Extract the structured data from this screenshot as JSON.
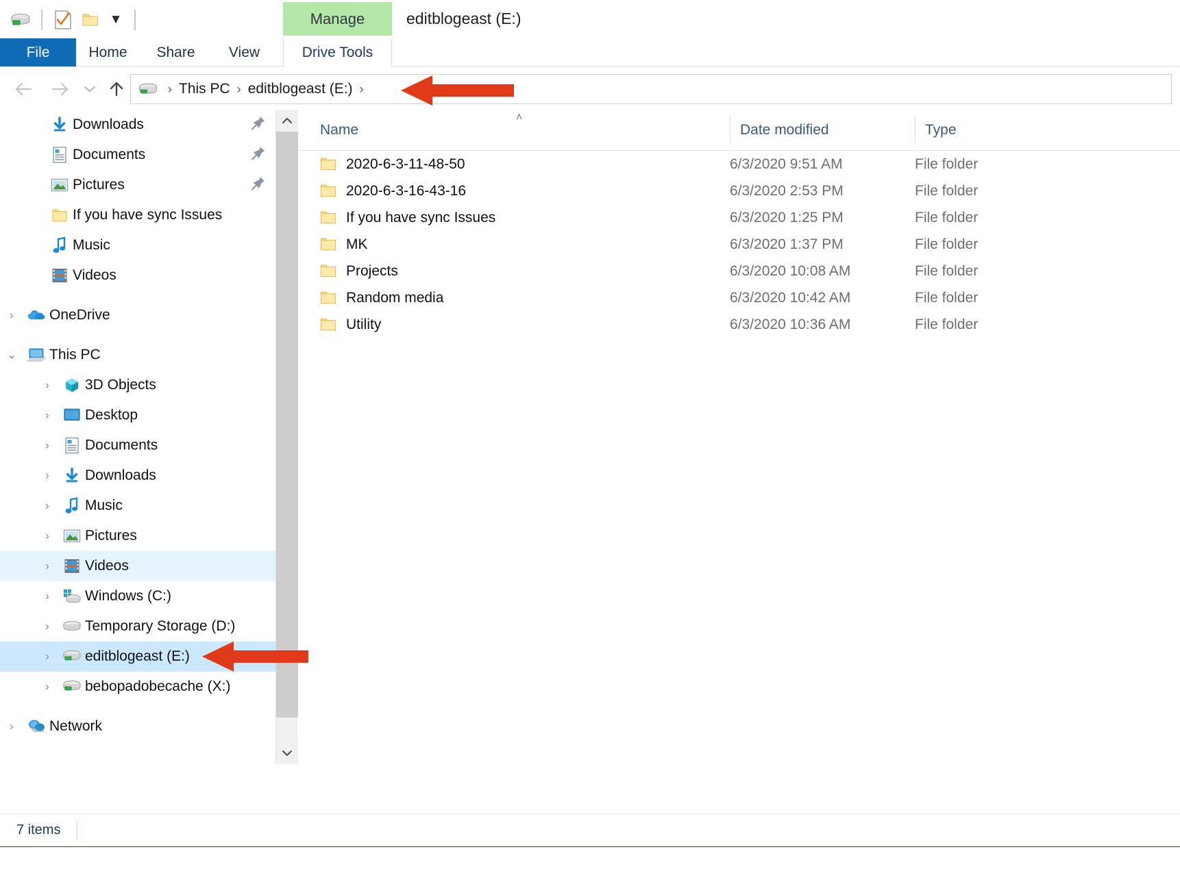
{
  "window": {
    "title": "editblogeast (E:)",
    "contextual_tab_group": "Manage",
    "accent_blue": "#0d6cb5",
    "contextual_green": "#b4e8a8",
    "selection_blue": "#cce8ff",
    "annotation_red": "#e03a18"
  },
  "quick_access_toolbar": {
    "drive_icon": "drive-icon",
    "properties_icon": "properties-checklist-icon",
    "new_folder_icon": "new-folder-icon",
    "customize_caret": "▼"
  },
  "ribbon": {
    "tabs": [
      {
        "label": "File",
        "name": "tab-file",
        "active": false
      },
      {
        "label": "Home",
        "name": "tab-home",
        "active": false
      },
      {
        "label": "Share",
        "name": "tab-share",
        "active": false
      },
      {
        "label": "View",
        "name": "tab-view",
        "active": false
      },
      {
        "label": "Drive Tools",
        "name": "tab-drive-tools",
        "active": true
      }
    ]
  },
  "navigation": {
    "back": "←",
    "forward": "→",
    "recent_locations": "⌄",
    "up": "↑",
    "breadcrumb": {
      "icon": "drive-icon",
      "items": [
        "This PC",
        "editblogeast (E:)"
      ],
      "separator": "›",
      "trailing_separator": "›"
    }
  },
  "sidebar": {
    "quick_access": [
      {
        "label": "Downloads",
        "icon": "downloads-arrow-icon",
        "pinned": true
      },
      {
        "label": "Documents",
        "icon": "document-icon",
        "pinned": true
      },
      {
        "label": "Pictures",
        "icon": "pictures-icon",
        "pinned": true
      },
      {
        "label": "If you have sync Issues",
        "icon": "folder-icon",
        "pinned": false
      },
      {
        "label": "Music",
        "icon": "music-note-icon",
        "pinned": false
      },
      {
        "label": "Videos",
        "icon": "videos-filmstrip-icon",
        "pinned": false
      }
    ],
    "onedrive": {
      "label": "OneDrive",
      "icon": "onedrive-cloud-icon",
      "expanded": false
    },
    "this_pc": {
      "label": "This PC",
      "icon": "this-pc-icon",
      "expanded": true
    },
    "this_pc_children": [
      {
        "label": "3D Objects",
        "icon": "3d-objects-icon",
        "expanded": false,
        "state": ""
      },
      {
        "label": "Desktop",
        "icon": "desktop-icon",
        "expanded": false,
        "state": ""
      },
      {
        "label": "Documents",
        "icon": "document-icon",
        "expanded": false,
        "state": ""
      },
      {
        "label": "Downloads",
        "icon": "downloads-arrow-icon",
        "expanded": false,
        "state": ""
      },
      {
        "label": "Music",
        "icon": "music-note-icon",
        "expanded": false,
        "state": ""
      },
      {
        "label": "Pictures",
        "icon": "pictures-icon",
        "expanded": false,
        "state": ""
      },
      {
        "label": "Videos",
        "icon": "videos-filmstrip-icon",
        "expanded": false,
        "state": "hover"
      },
      {
        "label": "Windows (C:)",
        "icon": "windows-drive-icon",
        "expanded": false,
        "state": ""
      },
      {
        "label": "Temporary Storage (D:)",
        "icon": "drive-icon",
        "expanded": false,
        "state": ""
      },
      {
        "label": "editblogeast (E:)",
        "icon": "network-drive-icon",
        "expanded": false,
        "state": "selected"
      },
      {
        "label": "bebopadobecache (X:)",
        "icon": "network-drive-icon",
        "expanded": false,
        "state": ""
      }
    ],
    "network": {
      "label": "Network",
      "icon": "network-icon",
      "expanded": false
    },
    "chevron_collapsed": "›",
    "chevron_expanded": "⌄",
    "pin_icon": "pin-icon"
  },
  "file_list": {
    "columns": [
      "Name",
      "Date modified",
      "Type"
    ],
    "sort_column": "Name",
    "sort_direction": "ascending",
    "sort_caret": "˄",
    "rows": [
      {
        "name": "2020-6-3-11-48-50",
        "date": "6/3/2020 9:51 AM",
        "type": "File folder",
        "icon": "folder-icon"
      },
      {
        "name": "2020-6-3-16-43-16",
        "date": "6/3/2020 2:53 PM",
        "type": "File folder",
        "icon": "folder-icon"
      },
      {
        "name": "If you have sync Issues",
        "date": "6/3/2020 1:25 PM",
        "type": "File folder",
        "icon": "folder-icon"
      },
      {
        "name": "MK",
        "date": "6/3/2020 1:37 PM",
        "type": "File folder",
        "icon": "folder-icon"
      },
      {
        "name": "Projects",
        "date": "6/3/2020 10:08 AM",
        "type": "File folder",
        "icon": "folder-icon"
      },
      {
        "name": "Random media",
        "date": "6/3/2020 10:42 AM",
        "type": "File folder",
        "icon": "folder-icon"
      },
      {
        "name": "Utility",
        "date": "6/3/2020 10:36 AM",
        "type": "File folder",
        "icon": "folder-icon"
      }
    ]
  },
  "status_bar": {
    "item_count": "7 items"
  },
  "annotations": [
    {
      "name": "breadcrumb-arrow",
      "points_to": "editblogeast (E:) breadcrumb",
      "direction": "left"
    },
    {
      "name": "drive-arrow",
      "points_to": "editblogeast (E:) sidebar drive",
      "direction": "left"
    }
  ]
}
